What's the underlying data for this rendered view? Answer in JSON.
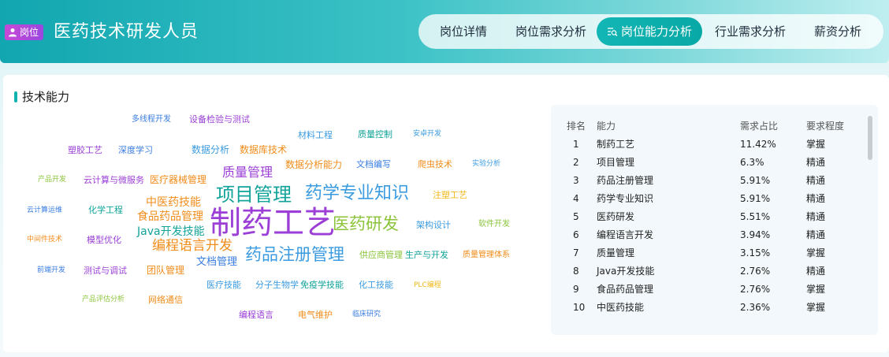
{
  "header": {
    "badge_label": "岗位",
    "title": "医药技术研发人员"
  },
  "tabs": [
    {
      "label": "岗位详情"
    },
    {
      "label": "岗位需求分析"
    },
    {
      "label": "岗位能力分析"
    },
    {
      "label": "行业需求分析"
    },
    {
      "label": "薪资分析"
    }
  ],
  "section": {
    "title": "技术能力"
  },
  "cloud_words": [
    {
      "text": "多线程开发",
      "color": "#3a7de0"
    },
    {
      "text": "设备检验与测试",
      "color": "#9b3fd6"
    },
    {
      "text": "材料工程",
      "color": "#3a9be0"
    },
    {
      "text": "质量控制",
      "color": "#12a39a"
    },
    {
      "text": "安卓开发",
      "color": "#3a9be0"
    },
    {
      "text": "塑胶工艺",
      "color": "#9b3fd6"
    },
    {
      "text": "深度学习",
      "color": "#3a7de0"
    },
    {
      "text": "数据分析",
      "color": "#3a9be0"
    },
    {
      "text": "数据库技术",
      "color": "#f08c1a"
    },
    {
      "text": "数据分析能力",
      "color": "#f08c1a"
    },
    {
      "text": "文档编写",
      "color": "#3a7de0"
    },
    {
      "text": "爬虫技术",
      "color": "#f08c1a"
    },
    {
      "text": "实验分析",
      "color": "#3a9be0"
    },
    {
      "text": "产品开发",
      "color": "#8bc43a"
    },
    {
      "text": "云计算与微服务",
      "color": "#9b3fd6"
    },
    {
      "text": "医疗器械管理",
      "color": "#f08c1a"
    },
    {
      "text": "质量管理",
      "color": "#9b3fd6"
    },
    {
      "text": "项目管理",
      "color": "#12a39a"
    },
    {
      "text": "药学专业知识",
      "color": "#3a9be0"
    },
    {
      "text": "注塑工艺",
      "color": "#f0b81a"
    },
    {
      "text": "云计算运维",
      "color": "#3a7de0"
    },
    {
      "text": "化学工程",
      "color": "#12a39a"
    },
    {
      "text": "中医药技能",
      "color": "#f08c1a"
    },
    {
      "text": "食品药品管理",
      "color": "#f08c1a"
    },
    {
      "text": "制药工艺",
      "color": "#9b3fd6"
    },
    {
      "text": "医药研发",
      "color": "#8bc43a"
    },
    {
      "text": "架构设计",
      "color": "#3a9be0"
    },
    {
      "text": "软件开发",
      "color": "#8bc43a"
    },
    {
      "text": "Java开发技能",
      "color": "#12a39a"
    },
    {
      "text": "中间件技术",
      "color": "#f08c1a"
    },
    {
      "text": "模型优化",
      "color": "#9b3fd6"
    },
    {
      "text": "编程语言开发",
      "color": "#f08c1a"
    },
    {
      "text": "文档管理",
      "color": "#3a7de0"
    },
    {
      "text": "药品注册管理",
      "color": "#3a9be0"
    },
    {
      "text": "供应商管理",
      "color": "#8bc43a"
    },
    {
      "text": "生产与开发",
      "color": "#12a39a"
    },
    {
      "text": "质量管理体系",
      "color": "#f08c1a"
    },
    {
      "text": "前端开发",
      "color": "#3a7de0"
    },
    {
      "text": "测试与调试",
      "color": "#9b3fd6"
    },
    {
      "text": "团队管理",
      "color": "#f08c1a"
    },
    {
      "text": "医疗技能",
      "color": "#3a9be0"
    },
    {
      "text": "分子生物学",
      "color": "#3a9be0"
    },
    {
      "text": "免疫学技能",
      "color": "#12a39a"
    },
    {
      "text": "化工技能",
      "color": "#3a9be0"
    },
    {
      "text": "PLC编程",
      "color": "#f0b81a"
    },
    {
      "text": "产品评估分析",
      "color": "#8bc43a"
    },
    {
      "text": "网络通信",
      "color": "#f08c1a"
    },
    {
      "text": "编程语言",
      "color": "#9b3fd6"
    },
    {
      "text": "电气维护",
      "color": "#f08c1a"
    },
    {
      "text": "临床研究",
      "color": "#3a7de0"
    }
  ],
  "table": {
    "headers": [
      "排名",
      "能力",
      "需求占比",
      "要求程度"
    ],
    "rows": [
      [
        "1",
        "制药工艺",
        "11.42%",
        "掌握"
      ],
      [
        "2",
        "项目管理",
        "6.3%",
        "精通"
      ],
      [
        "3",
        "药品注册管理",
        "5.91%",
        "精通"
      ],
      [
        "4",
        "药学专业知识",
        "5.91%",
        "精通"
      ],
      [
        "5",
        "医药研发",
        "5.51%",
        "精通"
      ],
      [
        "6",
        "编程语言开发",
        "3.94%",
        "精通"
      ],
      [
        "7",
        "质量管理",
        "3.15%",
        "掌握"
      ],
      [
        "8",
        "Java开发技能",
        "2.76%",
        "精通"
      ],
      [
        "9",
        "食品药品管理",
        "2.76%",
        "掌握"
      ],
      [
        "10",
        "中医药技能",
        "2.36%",
        "掌握"
      ]
    ]
  },
  "colors": {
    "accent": "#12b3ae",
    "badge": "#b247da"
  }
}
